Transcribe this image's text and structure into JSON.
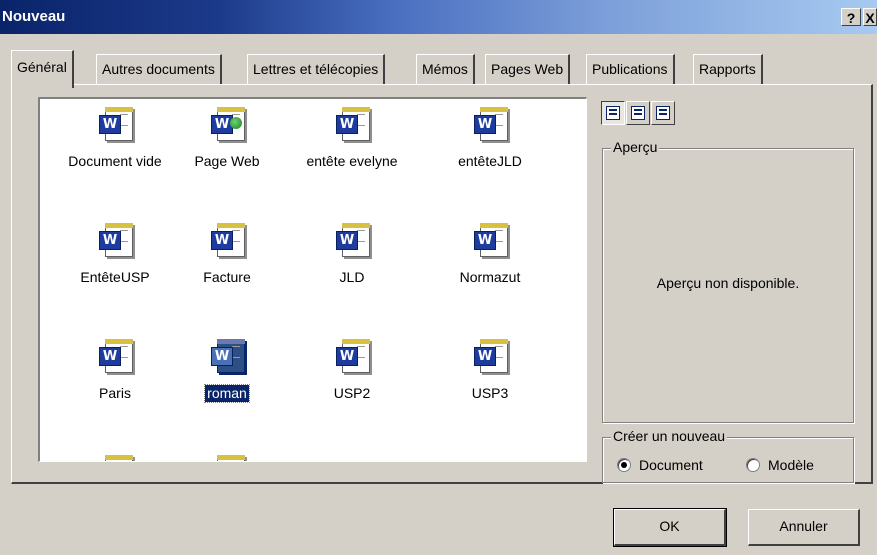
{
  "window": {
    "title": "Nouveau",
    "help_label": "?",
    "close_label": "X"
  },
  "tabs": [
    {
      "label": "Général",
      "active": true
    },
    {
      "label": "Autres documents"
    },
    {
      "label": "Lettres et télécopies"
    },
    {
      "label": "Mémos"
    },
    {
      "label": "Pages Web"
    },
    {
      "label": "Publications"
    },
    {
      "label": "Rapports"
    }
  ],
  "templates": [
    {
      "label": "Document vide",
      "icon": "word-document-icon"
    },
    {
      "label": "Page Web",
      "icon": "word-web-page-icon"
    },
    {
      "label": "entête evelyne",
      "icon": "word-document-icon"
    },
    {
      "label": "entêteJLD",
      "icon": "word-document-icon"
    },
    {
      "label": "EntêteUSP",
      "icon": "word-document-icon"
    },
    {
      "label": "Facture",
      "icon": "word-document-icon"
    },
    {
      "label": "JLD",
      "icon": "word-document-icon"
    },
    {
      "label": "Normazut",
      "icon": "word-document-icon"
    },
    {
      "label": "Paris",
      "icon": "word-document-icon"
    },
    {
      "label": "roman",
      "icon": "word-document-icon",
      "selected": true
    },
    {
      "label": "USP2",
      "icon": "word-document-icon"
    },
    {
      "label": "USP3",
      "icon": "word-document-icon"
    },
    {
      "label": "",
      "icon": "word-document-icon"
    },
    {
      "label": "",
      "icon": "word-document-icon"
    }
  ],
  "view_buttons": [
    "large-icons-view-icon",
    "list-view-icon",
    "details-view-icon"
  ],
  "preview": {
    "legend": "Aperçu",
    "message": "Aperçu non disponible."
  },
  "create_new": {
    "legend": "Créer un nouveau",
    "options": [
      {
        "label": "Document",
        "checked": true
      },
      {
        "label": "Modèle",
        "checked": false
      }
    ]
  },
  "buttons": {
    "ok": "OK",
    "cancel": "Annuler"
  },
  "colors": {
    "title_start": "#0a246a",
    "title_end": "#a6caf0",
    "selection": "#0a246a",
    "face": "#d4d0c8"
  }
}
